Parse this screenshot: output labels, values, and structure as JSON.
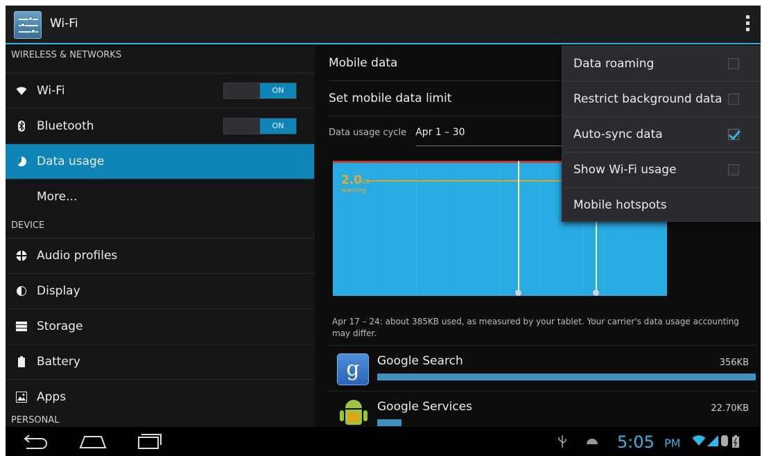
{
  "action_bar": {
    "title": "Wi-Fi",
    "app_icon": "settings-sliders-icon",
    "overflow_icon": "overflow-menu-icon"
  },
  "sidebar": {
    "headers": {
      "wireless": "WIRELESS & NETWORKS",
      "device": "DEVICE",
      "personal": "PERSONAL"
    },
    "items": [
      {
        "label": "Wi-Fi",
        "icon": "wifi-icon",
        "toggle": "ON"
      },
      {
        "label": "Bluetooth",
        "icon": "bluetooth-icon",
        "toggle": "ON"
      },
      {
        "label": "Data usage",
        "icon": "data-usage-icon",
        "selected": true
      },
      {
        "label": "More...",
        "icon": ""
      },
      {
        "label": "Audio profiles",
        "icon": "audio-profiles-icon"
      },
      {
        "label": "Display",
        "icon": "display-icon"
      },
      {
        "label": "Storage",
        "icon": "storage-icon"
      },
      {
        "label": "Battery",
        "icon": "battery-icon"
      },
      {
        "label": "Apps",
        "icon": "apps-icon"
      }
    ]
  },
  "data_usage": {
    "mobile_data": "Mobile data",
    "set_limit": "Set mobile data limit",
    "cycle_label": "Data usage cycle",
    "cycle_value": "Apr 1 – 30",
    "chart": {
      "warning_value": "2.0",
      "warning_unit": "GB",
      "warning_label": "warning"
    },
    "summary": "Apr 17 – 24: about 385KB used, as measured by your tablet. Your carrier's data usage accounting may differ.",
    "apps": [
      {
        "name": "Google Search",
        "size": "356KB",
        "usage_fraction": 1.0,
        "icon": "google-search-icon"
      },
      {
        "name": "Google Services",
        "size": "22.70KB",
        "usage_fraction": 0.064,
        "icon": "android-icon"
      }
    ]
  },
  "overflow_menu": {
    "items": [
      {
        "label": "Data roaming",
        "checked": false
      },
      {
        "label": "Restrict background data",
        "checked": false
      },
      {
        "label": "Auto-sync data",
        "checked": true
      },
      {
        "label": "Show Wi-Fi usage",
        "checked": false
      },
      {
        "label": "Mobile hotspots"
      }
    ]
  },
  "system_bar": {
    "time": "5:05",
    "ampm": "PM",
    "icons": [
      "back-icon",
      "home-icon",
      "recent-apps-icon",
      "usb-icon",
      "android-debug-icon",
      "wifi-signal-icon",
      "cell-signal-icon",
      "battery-status-icon"
    ]
  },
  "colors": {
    "accent": "#33b5e5",
    "selected": "#0e84b7",
    "chart_fill": "#29abe2",
    "warning": "#e8ab2d",
    "limit": "#c73b30"
  }
}
